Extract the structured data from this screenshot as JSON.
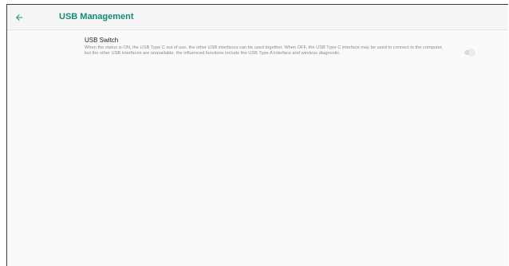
{
  "header": {
    "back_icon": "arrow-left-icon",
    "title": "USB Management",
    "accent_color": "#15897b"
  },
  "settings": {
    "usb_switch": {
      "title": "USB Switch",
      "description": "When the status is ON, the USB Type C out of use, the other USB interfaces can be used together. When OFF, the USB Type C interface may be used to connect to the computer, but the other USB interfaces are unavailable, the influenced functions include the USB Type A interface and wireless diagnostic.",
      "state": "off"
    }
  }
}
